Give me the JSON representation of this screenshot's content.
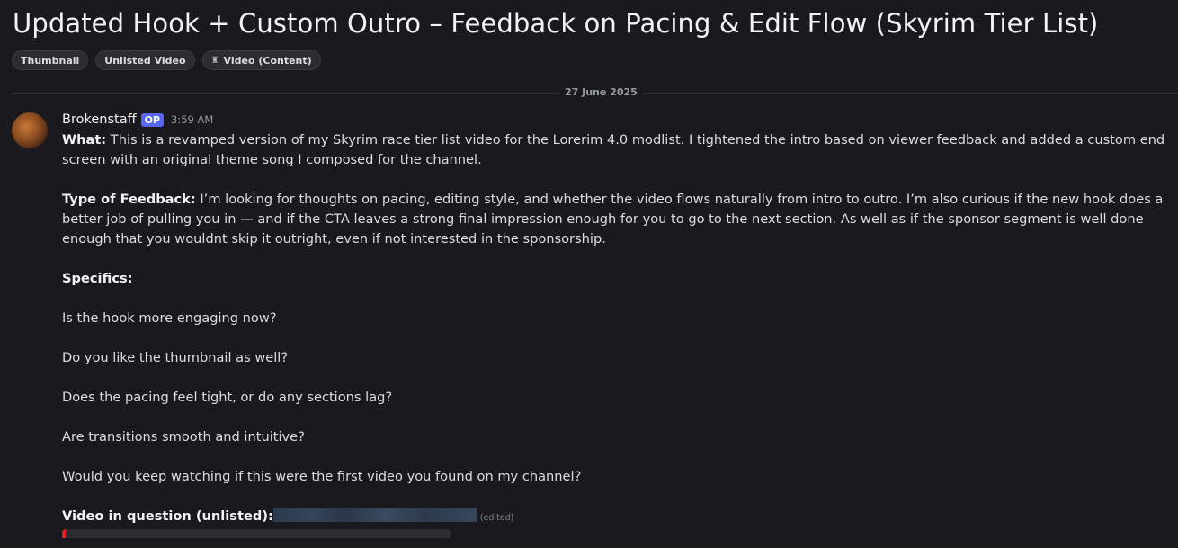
{
  "thread": {
    "title": "Updated Hook + Custom Outro – Feedback on Pacing & Edit Flow (Skyrim Tier List)",
    "tags": [
      {
        "label": "Thumbnail",
        "icon": ""
      },
      {
        "label": "Unlisted Video",
        "icon": ""
      },
      {
        "label": "Video (Content)",
        "icon": "trophy-icon"
      }
    ],
    "date_divider": "27 June 2025"
  },
  "message": {
    "author": "Brokenstaff",
    "op_badge": "OP",
    "timestamp": "3:59 AM",
    "what_label": "What:",
    "what_text": " This is a revamped version of my Skyrim race tier list video for the Lorerim 4.0 modlist. I tightened the intro based on viewer feedback and added a custom end screen with an original theme song I composed for the channel.",
    "feedback_label": "Type of Feedback:",
    "feedback_text": " I’m looking for thoughts on pacing, editing style, and whether the video flows naturally from intro to outro. I’m also curious if the new hook does a better job of pulling you in — and if the CTA leaves a strong final impression enough for you to go to the next section. As well as if the sponsor segment is well done enough that you wouldnt skip it outright, even if not interested in the sponsorship.",
    "specifics_label": "Specifics:",
    "questions": [
      "Is the hook more engaging now?",
      "Do you like the thumbnail as well?",
      "Does the pacing feel tight, or do any sections lag?",
      "Are transitions smooth and intuitive?",
      "Would you keep watching if this were the first video you found on my channel?"
    ],
    "video_label": "Video in question (unlisted)",
    "video_colon": ":",
    "edited": "(edited)",
    "embed_accent": "#e52222"
  }
}
